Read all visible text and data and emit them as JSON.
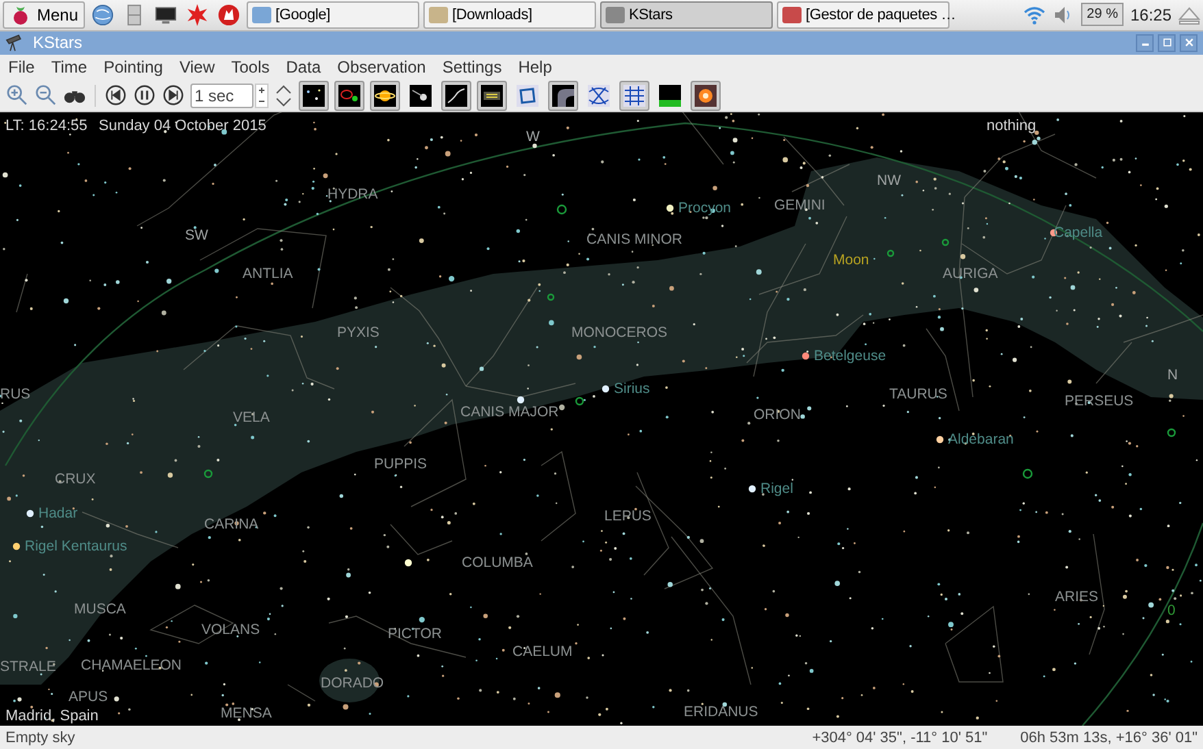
{
  "taskbar": {
    "menu_label": "Menu",
    "tasks": [
      {
        "label": "[Google]",
        "selected": false
      },
      {
        "label": "[Downloads]",
        "selected": false
      },
      {
        "label": "KStars",
        "selected": true
      },
      {
        "label": "[Gestor de paquetes …",
        "selected": false
      }
    ],
    "cpu": "29 %",
    "clock": "16:25"
  },
  "window": {
    "title": "KStars"
  },
  "menu": [
    "File",
    "Time",
    "Pointing",
    "View",
    "Tools",
    "Data",
    "Observation",
    "Settings",
    "Help"
  ],
  "toolbar": {
    "time_step": "1 sec",
    "toggles": [
      {
        "on": true
      },
      {
        "on": true
      },
      {
        "on": true
      },
      {
        "on": false
      },
      {
        "on": true
      },
      {
        "on": true
      },
      {
        "on": false
      },
      {
        "on": true
      },
      {
        "on": false
      },
      {
        "on": true
      },
      {
        "on": false
      },
      {
        "on": true
      }
    ]
  },
  "sky": {
    "time": "LT: 16:24:55",
    "date": "Sunday 04 October 2015",
    "focus": "nothing",
    "location": "Madrid, Spain",
    "labels": [
      {
        "text": "W",
        "kind": "compass"
      },
      {
        "text": "HYDRA",
        "kind": "constellation"
      },
      {
        "text": "Procyon",
        "kind": "star"
      },
      {
        "text": "GEMINI",
        "kind": "constellation"
      },
      {
        "text": "NW",
        "kind": "compass"
      },
      {
        "text": "SW",
        "kind": "compass"
      },
      {
        "text": "CANIS MINOR",
        "kind": "constellation"
      },
      {
        "text": "Capella",
        "kind": "star"
      },
      {
        "text": "ANTLIA",
        "kind": "constellation"
      },
      {
        "text": "Moon",
        "kind": "planet"
      },
      {
        "text": "AURIGA",
        "kind": "constellation"
      },
      {
        "text": "PYXIS",
        "kind": "constellation"
      },
      {
        "text": "MONOCEROS",
        "kind": "constellation"
      },
      {
        "text": "Betelgeuse",
        "kind": "star"
      },
      {
        "text": "N",
        "kind": "compass"
      },
      {
        "text": "RUS",
        "kind": "constellation"
      },
      {
        "text": "VELA",
        "kind": "constellation"
      },
      {
        "text": "CANIS MAJOR",
        "kind": "constellation"
      },
      {
        "text": "Sirius",
        "kind": "star"
      },
      {
        "text": "ORION",
        "kind": "constellation"
      },
      {
        "text": "TAURUS",
        "kind": "constellation"
      },
      {
        "text": "PERSEUS",
        "kind": "constellation"
      },
      {
        "text": "Aldebaran",
        "kind": "star"
      },
      {
        "text": "PUPPIS",
        "kind": "constellation"
      },
      {
        "text": "CRUX",
        "kind": "constellation"
      },
      {
        "text": "Rigel",
        "kind": "star"
      },
      {
        "text": "Hadar",
        "kind": "star"
      },
      {
        "text": "CARINA",
        "kind": "constellation"
      },
      {
        "text": "LEPUS",
        "kind": "constellation"
      },
      {
        "text": "Rigel Kentaurus",
        "kind": "star"
      },
      {
        "text": "COLUMBA",
        "kind": "constellation"
      },
      {
        "text": "MUSCA",
        "kind": "constellation"
      },
      {
        "text": "ARIES",
        "kind": "constellation"
      },
      {
        "text": "0",
        "kind": "marker"
      },
      {
        "text": "VOLANS",
        "kind": "constellation"
      },
      {
        "text": "PICTOR",
        "kind": "constellation"
      },
      {
        "text": "STRALE",
        "kind": "constellation"
      },
      {
        "text": "CHAMAELEON",
        "kind": "constellation"
      },
      {
        "text": "CAELUM",
        "kind": "constellation"
      },
      {
        "text": "APUS",
        "kind": "constellation"
      },
      {
        "text": "DORADO",
        "kind": "constellation"
      },
      {
        "text": "MENSA",
        "kind": "constellation"
      },
      {
        "text": "ERIDANUS",
        "kind": "constellation"
      }
    ]
  },
  "status_bar": {
    "object": "Empty sky",
    "horizontal": "+304° 04' 35\", -11° 10' 51\"",
    "equatorial": "06h 53m 13s, +16° 36' 01\""
  }
}
